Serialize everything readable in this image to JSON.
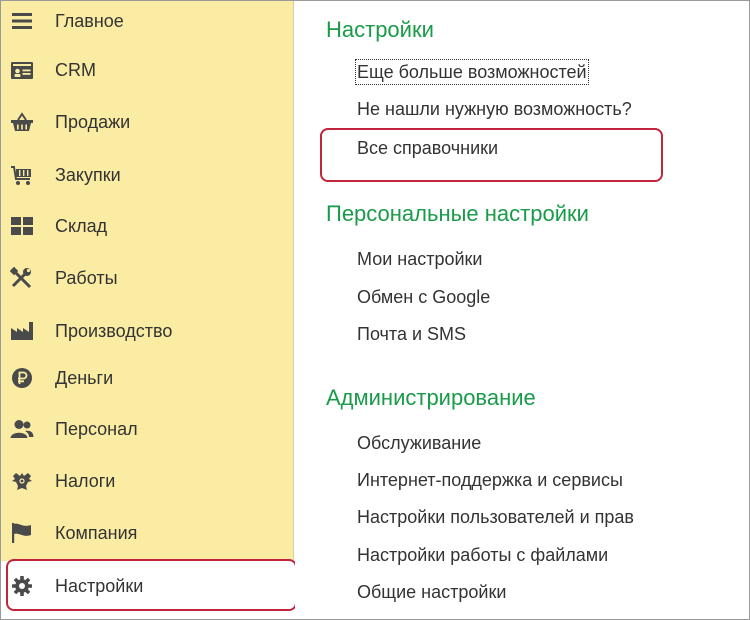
{
  "sidebar": {
    "items": [
      {
        "label": "Главное",
        "icon": "menu-icon"
      },
      {
        "label": "CRM",
        "icon": "crm-card-icon"
      },
      {
        "label": "Продажи",
        "icon": "basket-icon"
      },
      {
        "label": "Закупки",
        "icon": "cart-icon"
      },
      {
        "label": "Склад",
        "icon": "warehouse-boxes-icon"
      },
      {
        "label": "Работы",
        "icon": "tools-icon"
      },
      {
        "label": "Производство",
        "icon": "factory-icon"
      },
      {
        "label": "Деньги",
        "icon": "ruble-icon"
      },
      {
        "label": "Персонал",
        "icon": "people-icon"
      },
      {
        "label": "Налоги",
        "icon": "eagle-emblem-icon"
      },
      {
        "label": "Компания",
        "icon": "flag-icon"
      },
      {
        "label": "Настройки",
        "icon": "gear-icon"
      }
    ],
    "active_index": 11,
    "background": "#fbeca4"
  },
  "main": {
    "sections": [
      {
        "title": "Настройки",
        "links": [
          "Еще больше возможностей",
          "Не нашли нужную возможность?",
          "Все справочники"
        ]
      },
      {
        "title": "Персональные настройки",
        "links": [
          "Мои настройки",
          "Обмен с Google",
          "Почта и SMS"
        ]
      },
      {
        "title": "Администрирование",
        "links": [
          "Обслуживание",
          "Интернет-поддержка и сервисы",
          "Настройки пользователей и прав",
          "Настройки работы с файлами",
          "Общие настройки"
        ]
      }
    ]
  },
  "colors": {
    "section_title": "#199b4a",
    "highlight_border": "#c0253b",
    "text": "#333333"
  }
}
